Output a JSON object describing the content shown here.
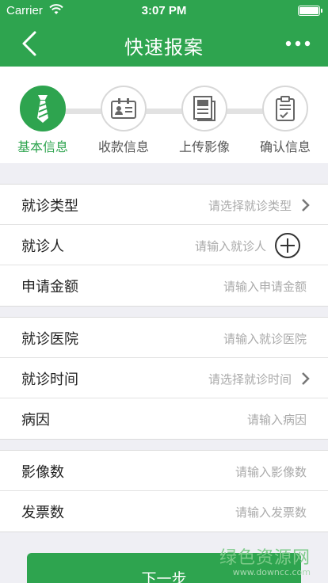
{
  "statusbar": {
    "carrier": "Carrier",
    "time": "3:07 PM"
  },
  "nav": {
    "title": "快速报案",
    "back_icon": "chevron-left-icon",
    "more_icon": "more-dots-icon"
  },
  "steps": [
    {
      "label": "基本信息",
      "icon": "tie-icon",
      "active": true
    },
    {
      "label": "收款信息",
      "icon": "id-card-icon",
      "active": false
    },
    {
      "label": "上传影像",
      "icon": "document-image-icon",
      "active": false
    },
    {
      "label": "确认信息",
      "icon": "clipboard-check-icon",
      "active": false
    }
  ],
  "form": {
    "group1": [
      {
        "label": "就诊类型",
        "value": "请选择就诊类型"
      },
      {
        "label": "就诊人",
        "value": "请输入就诊人"
      },
      {
        "label": "申请金额",
        "value": "请输入申请金额"
      }
    ],
    "group2": [
      {
        "label": "就诊医院",
        "value": "请输入就诊医院"
      },
      {
        "label": "就诊时间",
        "value": "请选择就诊时间"
      },
      {
        "label": "病因",
        "value": "请输入病因"
      }
    ],
    "group3": [
      {
        "label": "影像数",
        "value": "请输入影像数"
      },
      {
        "label": "发票数",
        "value": "请输入发票数"
      }
    ]
  },
  "next_button": "下一步",
  "watermark": {
    "main": "绿色资源网",
    "url": "www.downcc.com"
  },
  "colors": {
    "primary": "#2ea44f",
    "background": "#efeff4"
  }
}
